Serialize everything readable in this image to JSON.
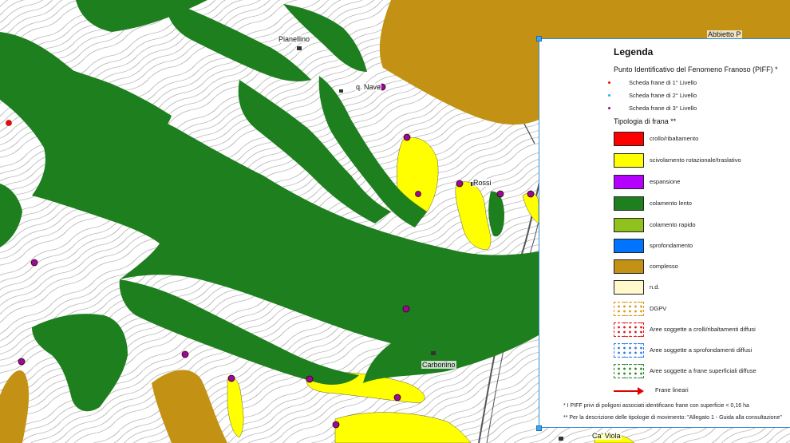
{
  "colors": {
    "crollo": "#ff0000",
    "scivolamento": "#ffff00",
    "espansione": "#b400ff",
    "colamento_lento": "#1e7f1e",
    "colamento_rapido": "#8fc21c",
    "sprofondamento": "#0073ff",
    "complesso": "#c39214",
    "nd": "#fff9cc",
    "dgpv_dots": "#d89a1a",
    "crolli_dots": "#e31a1a",
    "sprof_dots": "#2a7cf0",
    "frane_sup_dots": "#2e8a2e",
    "piff_1": "#ff0000",
    "piff_2": "#22aaff",
    "piff_3": "#9a0a9a"
  },
  "map": {
    "place_names": {
      "pianellino": "Pianellino",
      "nave": "q. Nave",
      "rossi": "Rossi",
      "carbonino": "Carbonino",
      "cavola": "Ca' Viola",
      "abbietto": "Abbietto P"
    }
  },
  "legend": {
    "title": "Legenda",
    "piff_title": "Punto Identificativo del Fenomeno Franoso (PIFF) *",
    "piff_items": [
      "Scheda frane di 1° Livello",
      "Scheda frane di 2° Livello",
      "Scheda frane di 3° Livello"
    ],
    "tipologia_title": "Tipologia di frana **",
    "tipologia_items": [
      "crollo/ribaltamento",
      "scivolamento rotazionale/traslativo",
      "espansione",
      "colamento lento",
      "colamento rapido",
      "sprofondamento",
      "complesso",
      "n.d.",
      "DGPV",
      "Aree soggette a crolli/ribaltamenti diffusi",
      "Aree soggette a sprofondamenti diffusi",
      "Aree soggette a frane superficiali diffuse"
    ],
    "linear_label": "Frane lineari",
    "note1": "* I PIFF privi di poligoni associati identificano frane con superficie < 0,16 ha",
    "note2": "** Per la descrizione delle tipologie di movimento: \"Allegato 1 - Guida alla consultazione\""
  }
}
